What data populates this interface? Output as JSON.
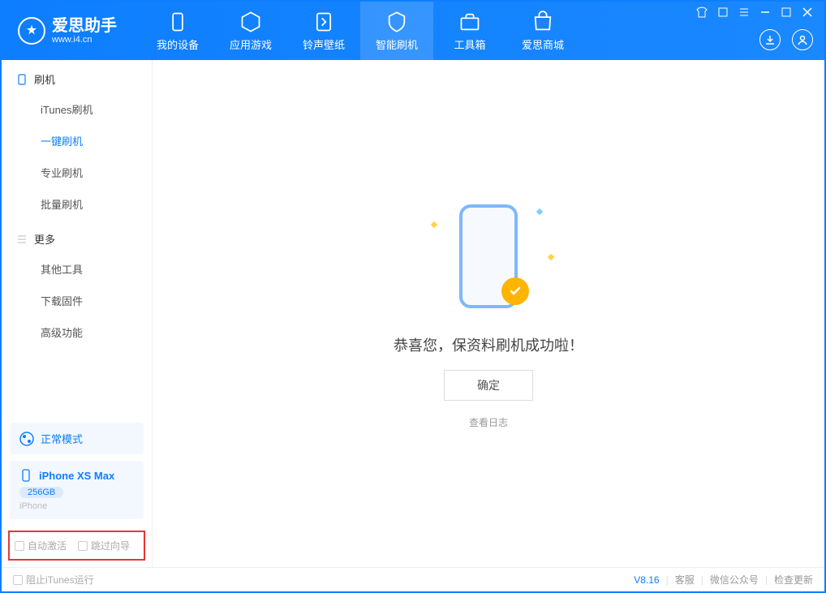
{
  "app": {
    "name": "爱思助手",
    "url": "www.i4.cn"
  },
  "nav": {
    "items": [
      {
        "label": "我的设备"
      },
      {
        "label": "应用游戏"
      },
      {
        "label": "铃声壁纸"
      },
      {
        "label": "智能刷机"
      },
      {
        "label": "工具箱"
      },
      {
        "label": "爱思商城"
      }
    ],
    "activeIndex": 3
  },
  "sidebar": {
    "sections": [
      {
        "title": "刷机",
        "items": [
          "iTunes刷机",
          "一键刷机",
          "专业刷机",
          "批量刷机"
        ],
        "activeIndex": 1
      },
      {
        "title": "更多",
        "items": [
          "其他工具",
          "下载固件",
          "高级功能"
        ],
        "activeIndex": -1
      }
    ],
    "modeCard": "正常模式",
    "device": {
      "name": "iPhone XS Max",
      "storage": "256GB",
      "type": "iPhone"
    },
    "checks": {
      "autoActivate": "自动激活",
      "skipGuide": "跳过向导"
    }
  },
  "main": {
    "message": "恭喜您，保资料刷机成功啦！",
    "okButton": "确定",
    "logLink": "查看日志"
  },
  "footer": {
    "blockItunes": "阻止iTunes运行",
    "version": "V8.16",
    "links": [
      "客服",
      "微信公众号",
      "检查更新"
    ]
  }
}
